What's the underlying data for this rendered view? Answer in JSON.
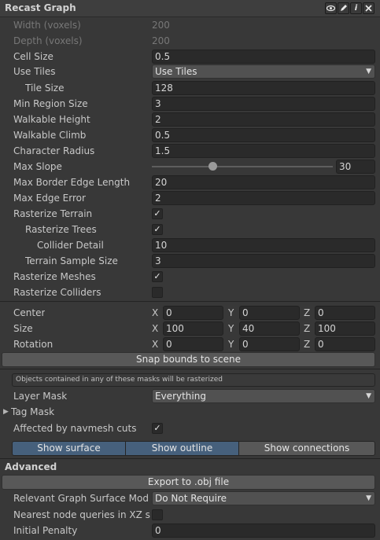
{
  "header": {
    "title": "Recast Graph",
    "eye_icon": "eye-icon",
    "pencil_icon": "pencil-icon",
    "info_icon": "info-icon",
    "close_icon": "close-icon"
  },
  "fields": {
    "width_label": "Width (voxels)",
    "width_value": "200",
    "depth_label": "Depth (voxels)",
    "depth_value": "200",
    "cell_size_label": "Cell Size",
    "cell_size_value": "0.5",
    "use_tiles_label": "Use Tiles",
    "use_tiles_value": "Use Tiles",
    "tile_size_label": "Tile Size",
    "tile_size_value": "128",
    "min_region_label": "Min Region Size",
    "min_region_value": "3",
    "walkable_height_label": "Walkable Height",
    "walkable_height_value": "2",
    "walkable_climb_label": "Walkable Climb",
    "walkable_climb_value": "0.5",
    "char_radius_label": "Character Radius",
    "char_radius_value": "1.5",
    "max_slope_label": "Max Slope",
    "max_slope_value": "30",
    "max_border_label": "Max Border Edge Length",
    "max_border_value": "20",
    "max_edge_error_label": "Max Edge Error",
    "max_edge_error_value": "2",
    "rasterize_terrain_label": "Rasterize Terrain",
    "rasterize_trees_label": "Rasterize Trees",
    "collider_detail_label": "Collider Detail",
    "collider_detail_value": "10",
    "terrain_sample_label": "Terrain Sample Size",
    "terrain_sample_value": "3",
    "rasterize_meshes_label": "Rasterize Meshes",
    "rasterize_colliders_label": "Rasterize Colliders",
    "checkmark": "✓"
  },
  "bounds": {
    "center_label": "Center",
    "size_label": "Size",
    "rotation_label": "Rotation",
    "x_axis": "X",
    "y_axis": "Y",
    "z_axis": "Z",
    "center": [
      "0",
      "0",
      "0"
    ],
    "size": [
      "100",
      "40",
      "100"
    ],
    "rotation": [
      "0",
      "0",
      "0"
    ],
    "snap_button": "Snap bounds to scene"
  },
  "masks": {
    "info_text": "Objects contained in any of these masks will be rasterized",
    "layer_mask_label": "Layer Mask",
    "layer_mask_value": "Everything",
    "tag_mask_label": "Tag Mask",
    "navmesh_cuts_label": "Affected by navmesh cuts"
  },
  "tabs": {
    "show_surface": "Show surface",
    "show_outline": "Show outline",
    "show_connections": "Show connections"
  },
  "advanced": {
    "title": "Advanced",
    "export_button": "Export to .obj file",
    "surface_mode_label": "Relevant Graph Surface Mode",
    "surface_mode_value": "Do Not Require",
    "nearest_label": "Nearest node queries in XZ spa",
    "initial_penalty_label": "Initial Penalty",
    "initial_penalty_value": "0"
  },
  "colors": {
    "background": "#383838",
    "field": "#2a2a2a",
    "accent_tab": "#46607c",
    "button": "#585858"
  }
}
